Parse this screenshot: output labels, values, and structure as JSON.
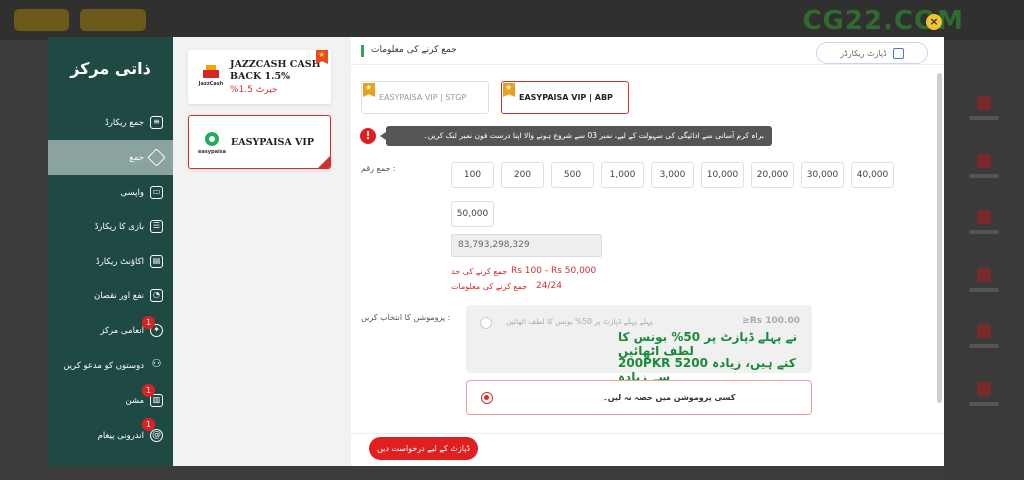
{
  "background": {
    "logo": "CG22.COM",
    "close_icon": "×"
  },
  "sidebar": {
    "title": "ذاتی مرکز",
    "items": [
      {
        "label": "جمع ریکارڈ",
        "icon": "wallet-icon",
        "badge": ""
      },
      {
        "label": "جمع",
        "icon": "deposit-icon",
        "badge": ""
      },
      {
        "label": "واپسی",
        "icon": "withdraw-icon",
        "badge": ""
      },
      {
        "label": "بازی کا ریکارڈ",
        "icon": "bet-record-icon",
        "badge": ""
      },
      {
        "label": "اکاؤنٹ ریکارڈ",
        "icon": "account-record-icon",
        "badge": ""
      },
      {
        "label": "نفع اور نقصان",
        "icon": "profit-loss-icon",
        "badge": ""
      },
      {
        "label": "انعامی مرکز",
        "icon": "reward-icon",
        "badge": "1"
      },
      {
        "label": "دوستوں کو مدعو کریں",
        "icon": "invite-icon",
        "badge": ""
      },
      {
        "label": "مشن",
        "icon": "gift-icon",
        "badge": "1"
      },
      {
        "label": "اندرونی پیغام",
        "icon": "message-icon",
        "badge": "1"
      }
    ]
  },
  "methods": [
    {
      "name": "JAZZCASH CASH BACK 1.5%",
      "sub": "%جیرٹ 1.5",
      "logo": "JazzCash"
    },
    {
      "name": "EASYPAISA VIP",
      "sub": "",
      "logo": "easypaisa"
    }
  ],
  "header": {
    "title": "جمع کرنے کی معلومات",
    "history_button": "ڈپازٹ ریکارڈز"
  },
  "vendors": [
    {
      "label": "EASYPAISA VIP | STGP"
    },
    {
      "label": "EASYPAISA VIP | ABP"
    }
  ],
  "notice": {
    "icon": "!",
    "text": "براہ کرم آسانی سے ادائیگی کی سہولت کے لیے، نمبر 03 سے شروع ہونے والا اپنا درست فون نمبر لنک کریں۔"
  },
  "amount": {
    "label": "جمع رقم :",
    "options": [
      "100",
      "200",
      "500",
      "1,000",
      "3,000",
      "10,000",
      "20,000",
      "30,000",
      "40,000",
      "50,000"
    ],
    "input_value": "83,793,298,329",
    "range_label": "جمع کرنے کی حد",
    "range_value": "Rs  100 - Rs  50,000",
    "count_label": "جمع کرنے کی معلومات",
    "count_value": "24/24"
  },
  "promo": {
    "label": "پروموشن کا انتخاب کریں :",
    "option1_small": "پہلے پہلے ڈپازٹ پر 50% بونس کا لطف اٹھائیں",
    "option1_amount": "≥Rs  100.00",
    "option1_line1": "نے پہلے ڈپازٹ پر 50% بونس کا لطف اٹھائیں",
    "option1_line2": "200PKR 5200 کتے ہیں، زیادہ سے زیادہ",
    "option2": "کسی پروموشن میں حصہ نہ لیں۔"
  },
  "footer": {
    "submit": "ڈپازٹ کے لیے درخواست دیں"
  },
  "colors": {
    "sidebar_bg": "#1f4a44",
    "accent_red": "#d32f2f",
    "promo_green": "#1a8a3a"
  }
}
